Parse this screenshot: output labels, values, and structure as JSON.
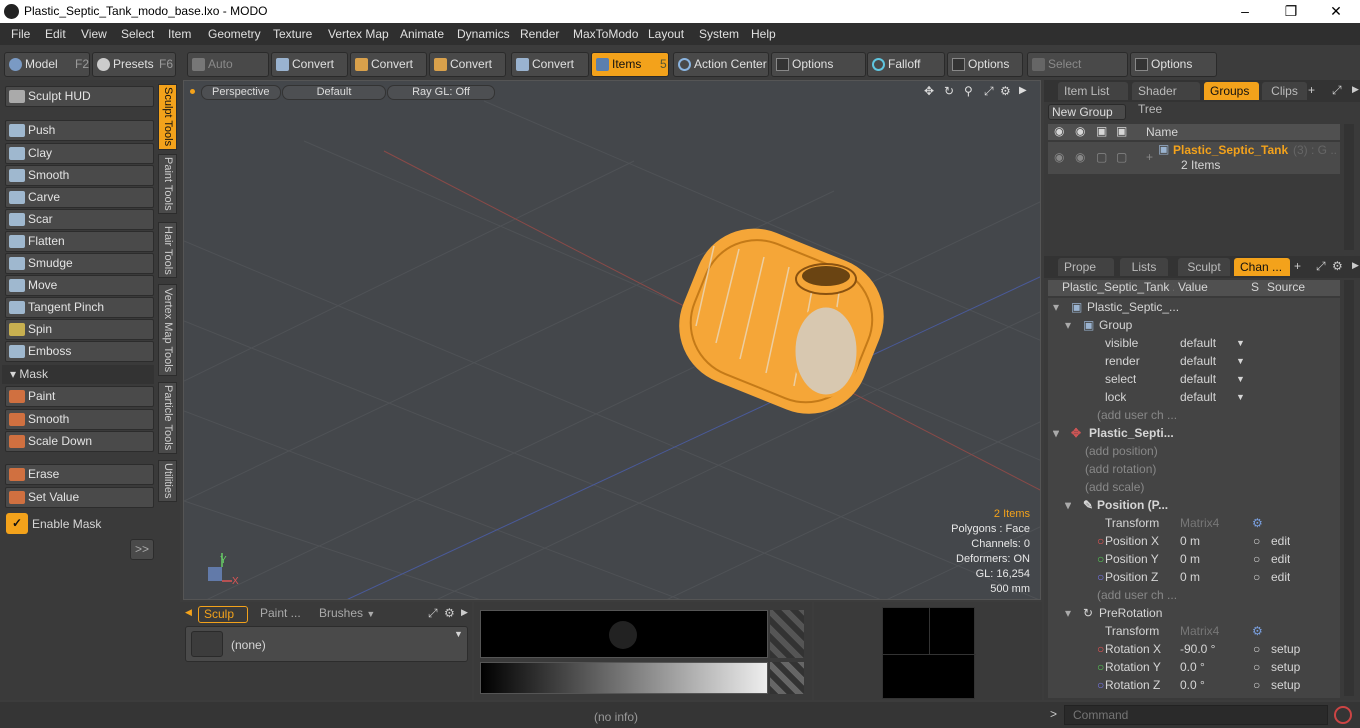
{
  "window": {
    "title": "Plastic_Septic_Tank_modo_base.lxo - MODO"
  },
  "menu": [
    "File",
    "Edit",
    "View",
    "Select",
    "Item",
    "Geometry",
    "Texture",
    "Vertex Map",
    "Animate",
    "Dynamics",
    "Render",
    "MaxToModo",
    "Layout",
    "System",
    "Help"
  ],
  "toolbar": {
    "model": "Model",
    "model_key": "F2",
    "presets": "Presets",
    "presets_key": "F6",
    "auto_select": "Auto Select",
    "convert": "Convert",
    "items": "Items",
    "items_key": "5",
    "action_center": "Action Center",
    "options": "Options",
    "falloff": "Falloff",
    "select_through": "Select Through"
  },
  "left": {
    "sculpt_hud": "Sculpt HUD",
    "tools": [
      "Push",
      "Clay",
      "Smooth",
      "Carve",
      "Scar",
      "Flatten",
      "Smudge",
      "Move",
      "Tangent Pinch",
      "Spin",
      "Emboss"
    ],
    "mask_header": "Mask",
    "mask_tools": [
      "Paint",
      "Smooth",
      "Scale Down"
    ],
    "erase": "Erase",
    "set_value": "Set Value",
    "enable_mask": "Enable Mask",
    "expand": ">>",
    "vtabs": [
      "Sculpt Tools",
      "Paint Tools",
      "Hair Tools",
      "Vertex Map Tools",
      "Particle Tools",
      "Utilities"
    ]
  },
  "viewport": {
    "view": "Perspective",
    "shading": "Default",
    "raygl": "Ray GL: Off",
    "items_count": "2 Items",
    "polygons": "Polygons : Face",
    "channels": "Channels: 0",
    "deformers": "Deformers: ON",
    "gl": "GL: 16,254",
    "units": "500 mm",
    "axis_y": "Y",
    "axis_x": "X"
  },
  "bottom": {
    "tabs": [
      "Sculp ...",
      "Paint ...",
      "Brushes"
    ],
    "none": "(none)"
  },
  "groups": {
    "tabs": [
      "Item List",
      "Shader Tree",
      "Groups",
      "Clips"
    ],
    "new_group": "New Group",
    "col_name": "Name",
    "group_name": "Plastic_Septic_Tank",
    "group_suffix": "(3) : G ...",
    "group_items": "2 Items"
  },
  "props": {
    "tabs": [
      "Prope ...",
      "Lists",
      "Sculpt",
      "Chan ..."
    ],
    "col1": "Plastic_Septic_Tank ...",
    "col_value": "Value",
    "col_s": "S",
    "col_source": "Source",
    "rows": [
      {
        "name": "Plastic_Septic_...",
        "value": "",
        "src": ""
      },
      {
        "name": "Group",
        "value": "",
        "src": ""
      },
      {
        "name": "visible",
        "value": "default",
        "src": ""
      },
      {
        "name": "render",
        "value": "default",
        "src": ""
      },
      {
        "name": "select",
        "value": "default",
        "src": ""
      },
      {
        "name": "lock",
        "value": "default",
        "src": ""
      },
      {
        "name": "(add user ch ...",
        "value": "",
        "src": ""
      },
      {
        "name": "Plastic_Septi...",
        "value": "",
        "src": ""
      },
      {
        "name": "(add position)",
        "value": "",
        "src": ""
      },
      {
        "name": "(add rotation)",
        "value": "",
        "src": ""
      },
      {
        "name": "(add scale)",
        "value": "",
        "src": ""
      },
      {
        "name": "Position (P...",
        "value": "",
        "src": ""
      },
      {
        "name": "Transform",
        "value": "Matrix4",
        "src": ""
      },
      {
        "name": "Position X",
        "value": "0 m",
        "src": "edit"
      },
      {
        "name": "Position Y",
        "value": "0 m",
        "src": "edit"
      },
      {
        "name": "Position Z",
        "value": "0 m",
        "src": "edit"
      },
      {
        "name": "(add user ch ...",
        "value": "",
        "src": ""
      },
      {
        "name": "PreRotation",
        "value": "",
        "src": ""
      },
      {
        "name": "Transform",
        "value": "Matrix4",
        "src": ""
      },
      {
        "name": "Rotation X",
        "value": "-90.0 °",
        "src": "setup"
      },
      {
        "name": "Rotation Y",
        "value": "0.0 °",
        "src": "setup"
      },
      {
        "name": "Rotation Z",
        "value": "0.0 °",
        "src": "setup"
      }
    ]
  },
  "status": {
    "info": "(no info)",
    "command_placeholder": "Command"
  },
  "colors": {
    "accent": "#f3a21b",
    "panel": "#3a3a3a"
  }
}
